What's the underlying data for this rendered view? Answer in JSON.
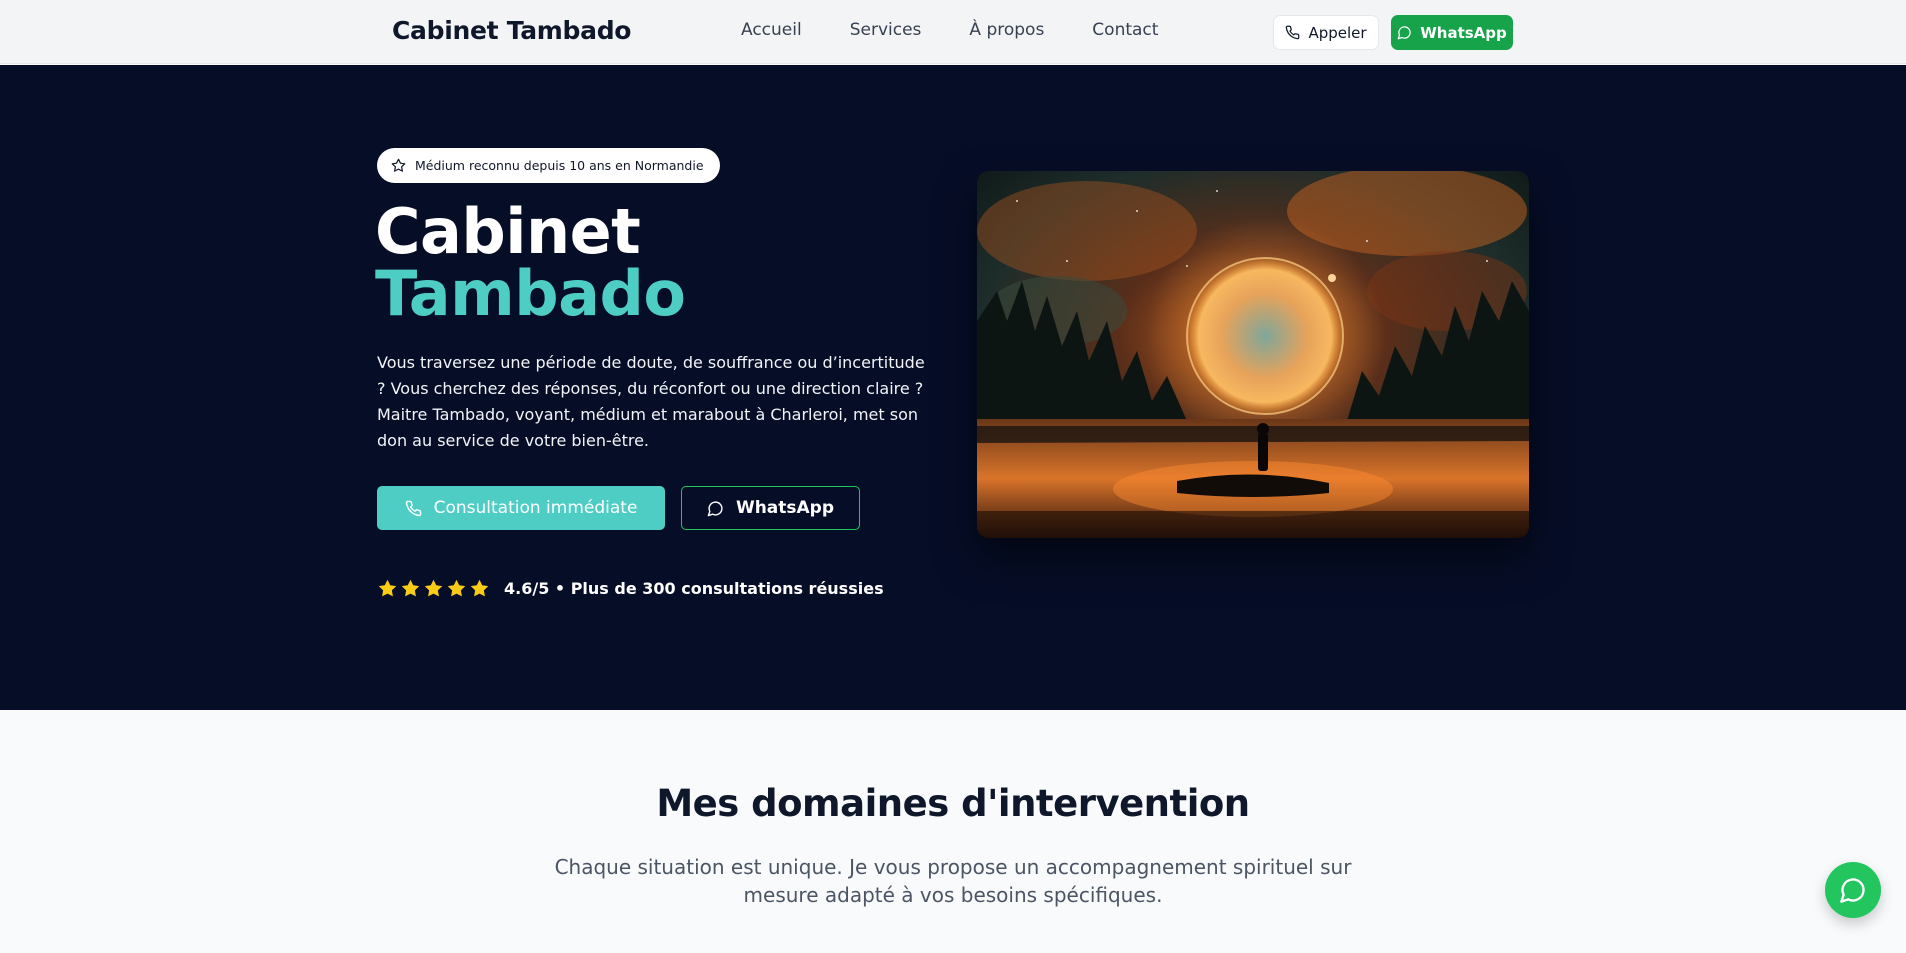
{
  "header": {
    "brand": "Cabinet Tambado",
    "nav": [
      "Accueil",
      "Services",
      "À propos",
      "Contact"
    ],
    "call_label": "Appeler",
    "whatsapp_label": "WhatsApp"
  },
  "hero": {
    "badge": "Médium reconnu depuis 10 ans en Normandie",
    "title_line1": "Cabinet",
    "title_line2": "Tambado",
    "lead": "Vous traversez une période de doute, de souffrance ou d’incertitude ? Vous cherchez des réponses, du réconfort ou une direction claire ? Maitre Tambado, voyant, médium et marabout à Charleroi, met son don au service de votre bien-être.",
    "consult_label": "Consultation immédiate",
    "whatsapp_label": "WhatsApp",
    "rating_stars": 5,
    "rating_text": "4.6/5 • Plus de 300 consultations réussies"
  },
  "section": {
    "title": "Mes domaines d'intervention",
    "subtitle": "Chaque situation est unique. Je vous propose un accompagnement spirituel sur mesure adapté à vos besoins spécifiques."
  },
  "colors": {
    "accent": "#4ecdc4",
    "whatsapp": "#16a34a",
    "hero_bg": "#060d26",
    "star": "#facc15"
  },
  "icons": {
    "call": "phone-icon",
    "whatsapp": "chat-bubble-icon",
    "badge": "star-outline-icon",
    "rating": "star-icon"
  }
}
